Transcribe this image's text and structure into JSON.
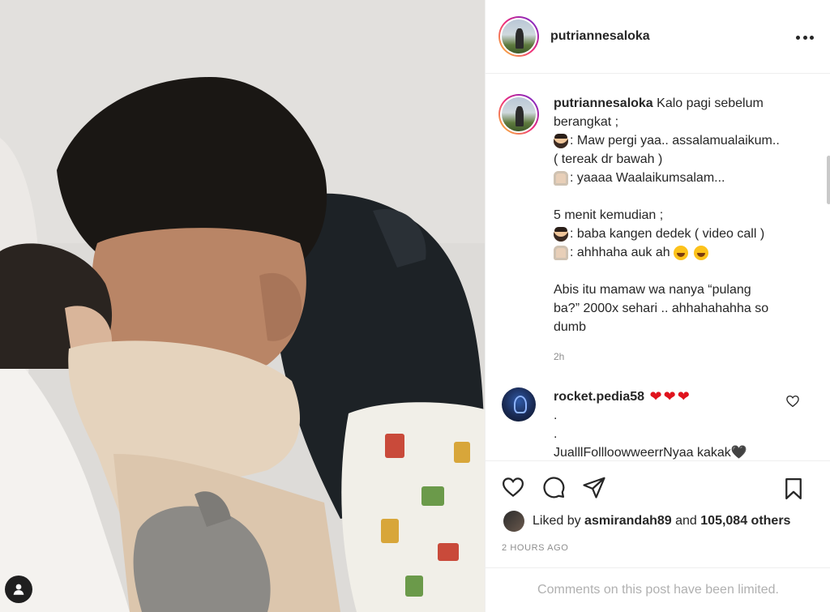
{
  "post": {
    "username": "putriannesaloka",
    "more_icon": "more-horizontal-icon",
    "caption": {
      "first_line": "Kalo pagi sebelum",
      "line2": "berangkat ;",
      "line3": ": Maw pergi yaa.. assalamualaikum..",
      "line4": "( tereak dr bawah )",
      "line5": ": yaaaa Waalaikumsalam...",
      "line6": "5 menit kemudian ;",
      "line7": ": baba kangen dedek ( video call )",
      "line8": " : ahhhaha auk ah ",
      "line9": "Abis itu mamaw wa nanya “pulang",
      "line10": "ba?” 2000x sehari .. ahhahahahha so",
      "line11": "dumb",
      "time": "2h"
    },
    "comment": {
      "username": "rocket.pedia58",
      "line2": ".",
      "line3": ".",
      "line4": "JualllFollloowweerrNyaa kakak",
      "line4_suffix": "🖤"
    },
    "likes": {
      "prefix": "Liked by",
      "user": "asmirandah89",
      "and": "and",
      "others": "105,084 others"
    },
    "time_ago": "2 HOURS AGO",
    "comments_limited": "Comments on this post have been limited."
  },
  "colors": {
    "heart": "#e0131d",
    "text": "#262626",
    "muted": "#8e8e8e",
    "border": "#efefef"
  }
}
